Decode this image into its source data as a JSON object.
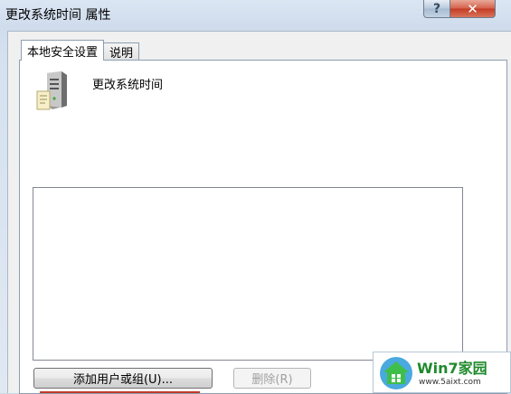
{
  "window": {
    "title": "更改系统时间 属性",
    "help_glyph": "?",
    "close_glyph": "✕"
  },
  "tabs": [
    {
      "label": "本地安全设置",
      "active": true
    },
    {
      "label": "说明",
      "active": false
    }
  ],
  "policy": {
    "name": "更改系统时间",
    "icon": "server-computer-icon"
  },
  "users_list": {
    "items": []
  },
  "buttons": {
    "add_label": "添加用户或组(U)...",
    "remove_label": "删除(R)",
    "remove_enabled": false
  },
  "watermark": {
    "title": "Win7家园",
    "url": "www.5aixt.com"
  },
  "colors": {
    "annotation_underline": "#c0392b",
    "close_button": "#c33b22"
  }
}
